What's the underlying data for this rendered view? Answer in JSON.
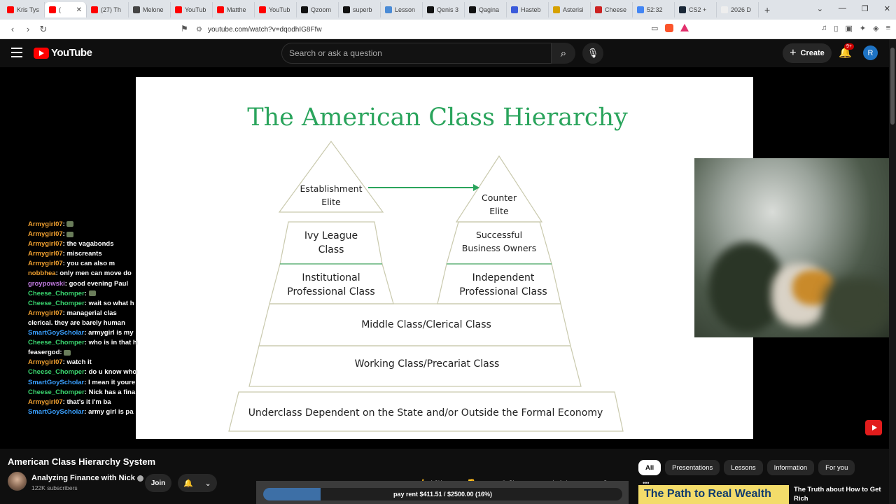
{
  "browser": {
    "tabs": [
      {
        "label": "Kris Tys",
        "color": "#ff0000"
      },
      {
        "label": "(",
        "color": "#ff0000",
        "active": true
      },
      {
        "label": "(27) Th",
        "color": "#ff0000"
      },
      {
        "label": "Melone",
        "color": "#444444"
      },
      {
        "label": "YouTub",
        "color": "#ff0000"
      },
      {
        "label": "Matthe",
        "color": "#ff0000"
      },
      {
        "label": "YouTub",
        "color": "#ff0000"
      },
      {
        "label": "Qzoom",
        "color": "#111111"
      },
      {
        "label": "superb",
        "color": "#111111"
      },
      {
        "label": "Lesson",
        "color": "#4a8bd6"
      },
      {
        "label": "Qenis 3",
        "color": "#111111"
      },
      {
        "label": "Qagina",
        "color": "#111111"
      },
      {
        "label": "Hasteb",
        "color": "#3b5bdb"
      },
      {
        "label": "Asterisi",
        "color": "#d6a100"
      },
      {
        "label": "Cheese",
        "color": "#cc2222"
      },
      {
        "label": "52:32",
        "color": "#4285f4"
      },
      {
        "label": "CS2 +",
        "color": "#1b2838"
      },
      {
        "label": "2026 D",
        "color": "#eeeeee"
      }
    ],
    "url": "youtube.com/watch?v=dqodhIG8Ffw"
  },
  "youtube": {
    "logo_text": "YouTube",
    "search_placeholder": "Search or ask a question",
    "create_label": "Create",
    "notif_badge": "9+",
    "avatar_letter": "R"
  },
  "slide": {
    "title": "The American Class Hierarchy",
    "left_top": [
      "Establishment",
      "Elite"
    ],
    "right_top": [
      "Counter",
      "Elite"
    ],
    "left_mid": [
      "Ivy League",
      "Class"
    ],
    "right_mid": [
      "Successful",
      "Business Owners"
    ],
    "left_low": [
      "Institutional",
      "Professional Class"
    ],
    "right_low": [
      "Independent",
      "Professional Class"
    ],
    "middle": "Middle Class/Clerical Class",
    "working": "Working Class/Precariat Class",
    "under": "Underclass Dependent on the State and/or Outside the Formal Economy"
  },
  "chat": [
    {
      "user": "Armygirl07",
      "color": "#f0a030",
      "msg": ""
    },
    {
      "user": "Armygirl07",
      "color": "#f0a030",
      "msg": ""
    },
    {
      "user": "Armygirl07",
      "color": "#f0a030",
      "msg": "the vagabonds"
    },
    {
      "user": "Armygirl07",
      "color": "#f0a030",
      "msg": "miscreants"
    },
    {
      "user": "Armygirl07",
      "color": "#f0a030",
      "msg": "you can also m"
    },
    {
      "user": "nobbhea",
      "color": "#f0a030",
      "msg": "only men can move do"
    },
    {
      "user": "groypowski",
      "color": "#c07adf",
      "msg": "good evening Paul"
    },
    {
      "user": "Cheese_Chomper",
      "color": "#39d36e",
      "msg": ""
    },
    {
      "user": "Cheese_Chomper",
      "color": "#39d36e",
      "msg": "wait so what h"
    },
    {
      "user": "Armygirl07",
      "color": "#f0a030",
      "msg": "managerial clas"
    },
    {
      "user": "",
      "color": "#ffffff",
      "msg": "clerical. they are barely human"
    },
    {
      "user": "SmartGoyScholar",
      "color": "#3aa0ff",
      "msg": "armygirl is my"
    },
    {
      "user": "Cheese_Chomper",
      "color": "#39d36e",
      "msg": "who is in that h"
    },
    {
      "user": "feasergod",
      "color": "#ffffff",
      "msg": ""
    },
    {
      "user": "Armygirl07",
      "color": "#f0a030",
      "msg": "watch it"
    },
    {
      "user": "Cheese_Chomper",
      "color": "#39d36e",
      "msg": "do u know who"
    },
    {
      "user": "SmartGoyScholar",
      "color": "#3aa0ff",
      "msg": "I mean it youre"
    },
    {
      "user": "Cheese_Chomper",
      "color": "#39d36e",
      "msg": "Nick has a fina"
    },
    {
      "user": "Armygirl07",
      "color": "#f0a030",
      "msg": "that's it i'm ba"
    },
    {
      "user": "SmartGoyScholar",
      "color": "#3aa0ff",
      "msg": "army girl is pa"
    }
  ],
  "video": {
    "title": "American Class Hierarchy System",
    "channel": "Analyzing Finance with Nick",
    "subscribers": "122K subscribers",
    "join_label": "Join",
    "likes": "4.2K",
    "share_label": "Share",
    "ask_label": "Ask",
    "save_label": "Save",
    "progress_text": "pay rent $411.51 / $2500.00 (16%)",
    "progress_fraction": 0.16
  },
  "chips": [
    "All",
    "Presentations",
    "Lessons",
    "Information",
    "For you"
  ],
  "recommendation": {
    "thumb_text": "The Path to Real Wealth",
    "title": "The Truth about How to Get Rich"
  }
}
